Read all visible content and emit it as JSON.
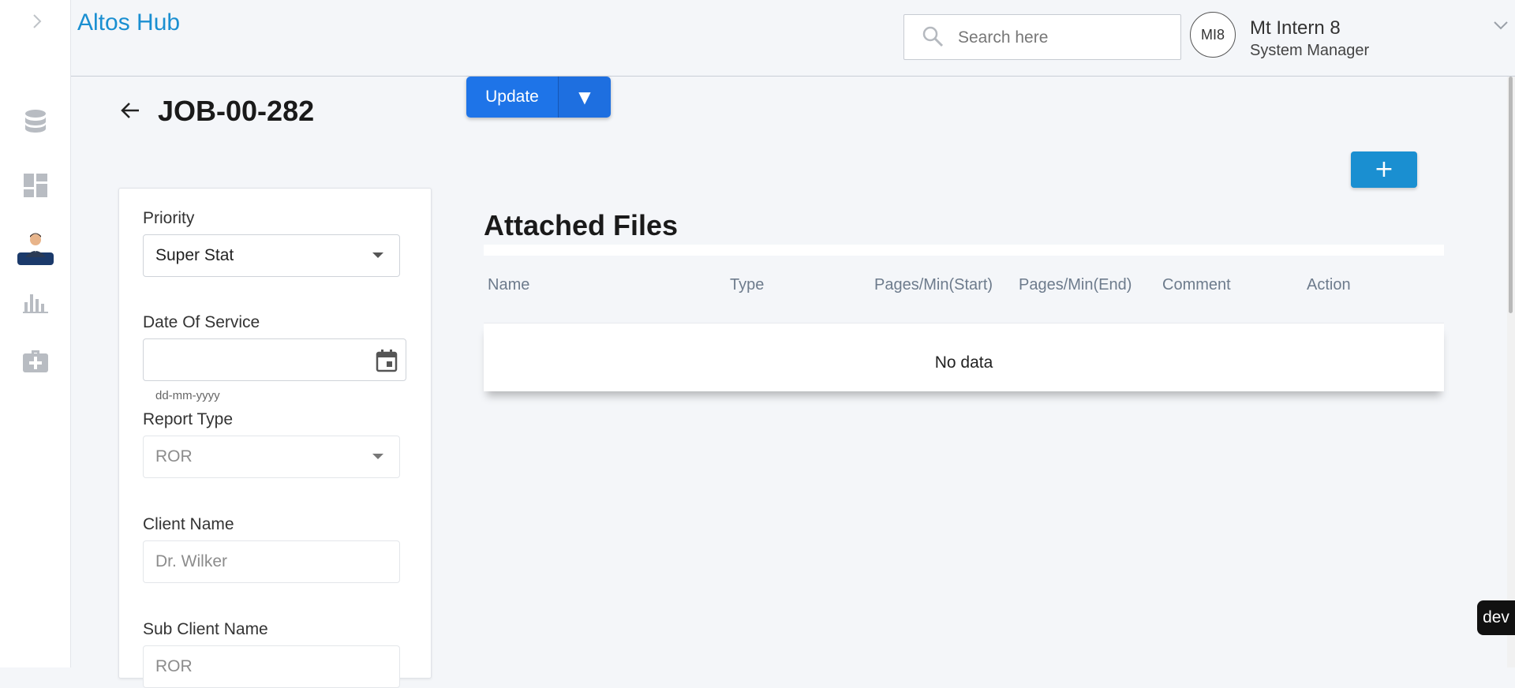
{
  "app": {
    "brand": "Altos Hub"
  },
  "search": {
    "placeholder": "Search here"
  },
  "user": {
    "initials": "MI8",
    "name": "Mt Intern 8",
    "role": "System Manager"
  },
  "sidebar": {
    "items": [
      {
        "icon": "database-icon"
      },
      {
        "icon": "dashboard-icon"
      },
      {
        "icon": "profile-avatar-icon",
        "active": true
      },
      {
        "icon": "bar-chart-icon"
      },
      {
        "icon": "medical-kit-icon"
      }
    ]
  },
  "page": {
    "title": "JOB-00-282",
    "update_label": "Update",
    "dropdown_glyph": "▼"
  },
  "form": {
    "priority": {
      "label": "Priority",
      "value": "Super Stat"
    },
    "date_of_service": {
      "label": "Date Of Service",
      "value": "",
      "hint": "dd-mm-yyyy"
    },
    "report_type": {
      "label": "Report Type",
      "value": "ROR"
    },
    "client_name": {
      "label": "Client Name",
      "placeholder": "Dr. Wilker"
    },
    "sub_client_name": {
      "label": "Sub Client Name",
      "placeholder": "ROR"
    }
  },
  "files": {
    "add_label": "+",
    "title": "Attached Files",
    "columns": [
      "Name",
      "Type",
      "Pages/Min(Start)",
      "Pages/Min(End)",
      "Comment",
      "Action"
    ],
    "empty_text": "No data"
  },
  "env_badge": "dev",
  "colors": {
    "brand": "#1a8fd1",
    "primary": "#1e74e8"
  }
}
